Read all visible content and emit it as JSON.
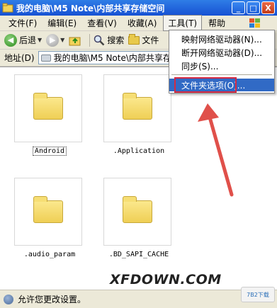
{
  "window": {
    "title": "我的电脑\\M5 Note\\内部共享存储空间",
    "minimize_label": "_",
    "maximize_label": "□",
    "close_label": "X"
  },
  "menu": {
    "items": [
      "文件(F)",
      "编辑(E)",
      "查看(V)",
      "收藏(A)",
      "工具(T)",
      "帮助"
    ]
  },
  "toolbar": {
    "back_label": "后退",
    "search_label": "搜索",
    "folders_label": "文件"
  },
  "address": {
    "label": "地址(D)",
    "path": "我的电脑\\M5 Note\\内部共享存储"
  },
  "files": [
    {
      "name": "Android",
      "selected": true
    },
    {
      "name": ".Application",
      "selected": false
    },
    {
      "name": ".audio_param",
      "selected": false
    },
    {
      "name": ".BD_SAPI_CACHE",
      "selected": false
    }
  ],
  "tools_menu": {
    "items": [
      "映射网络驱动器(N)...",
      "断开网络驱动器(D)...",
      "同步(S)...",
      "文件夹选项(O)..."
    ],
    "highlighted_index": 3,
    "accent_color": "#316ac5",
    "callout_color": "#d42a44"
  },
  "status": {
    "text": "允许您更改设置。"
  },
  "watermark": {
    "text": "XFDOWN.COM",
    "badge": "7B2下载"
  }
}
